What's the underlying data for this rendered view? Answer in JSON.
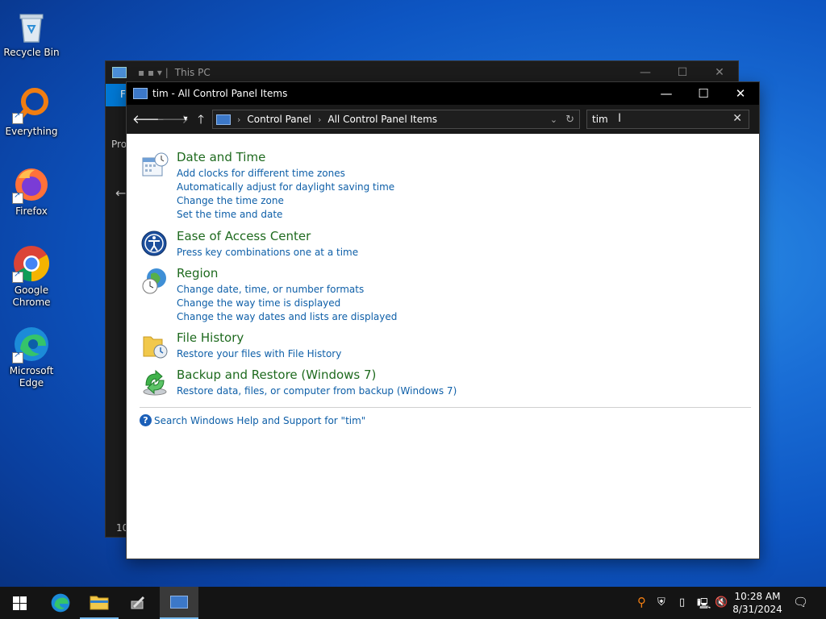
{
  "desktop": {
    "icons": [
      {
        "label": "Recycle Bin"
      },
      {
        "label": "Everything"
      },
      {
        "label": "Firefox"
      },
      {
        "label": "Google Chrome"
      },
      {
        "label": "Microsoft Edge"
      }
    ]
  },
  "background_window": {
    "title": "This PC",
    "ribbon_letter": "F",
    "left_text": "Pro",
    "bottom_text": "10"
  },
  "window": {
    "title": "tim - All Control Panel Items",
    "breadcrumb": [
      "Control Panel",
      "All Control Panel Items"
    ],
    "search_value": "tim",
    "groups": [
      {
        "title": "Date and Time",
        "tasks": [
          "Add clocks for different time zones",
          "Automatically adjust for daylight saving time",
          "Change the time zone",
          "Set the time and date"
        ]
      },
      {
        "title": "Ease of Access Center",
        "tasks": [
          "Press key combinations one at a time"
        ]
      },
      {
        "title": "Region",
        "tasks": [
          "Change date, time, or number formats",
          "Change the way time is displayed",
          "Change the way dates and lists are displayed"
        ]
      },
      {
        "title": "File History",
        "tasks": [
          "Restore your files with File History"
        ]
      },
      {
        "title": "Backup and Restore (Windows 7)",
        "tasks": [
          "Restore data, files, or computer from backup (Windows 7)"
        ]
      }
    ],
    "help_link": "Search Windows Help and Support for \"tim\""
  },
  "taskbar": {
    "time": "10:28 AM",
    "date": "8/31/2024"
  },
  "colors": {
    "accent": "#0078d4",
    "category_title": "#1e6a1e",
    "task_link": "#0e5fa8"
  }
}
